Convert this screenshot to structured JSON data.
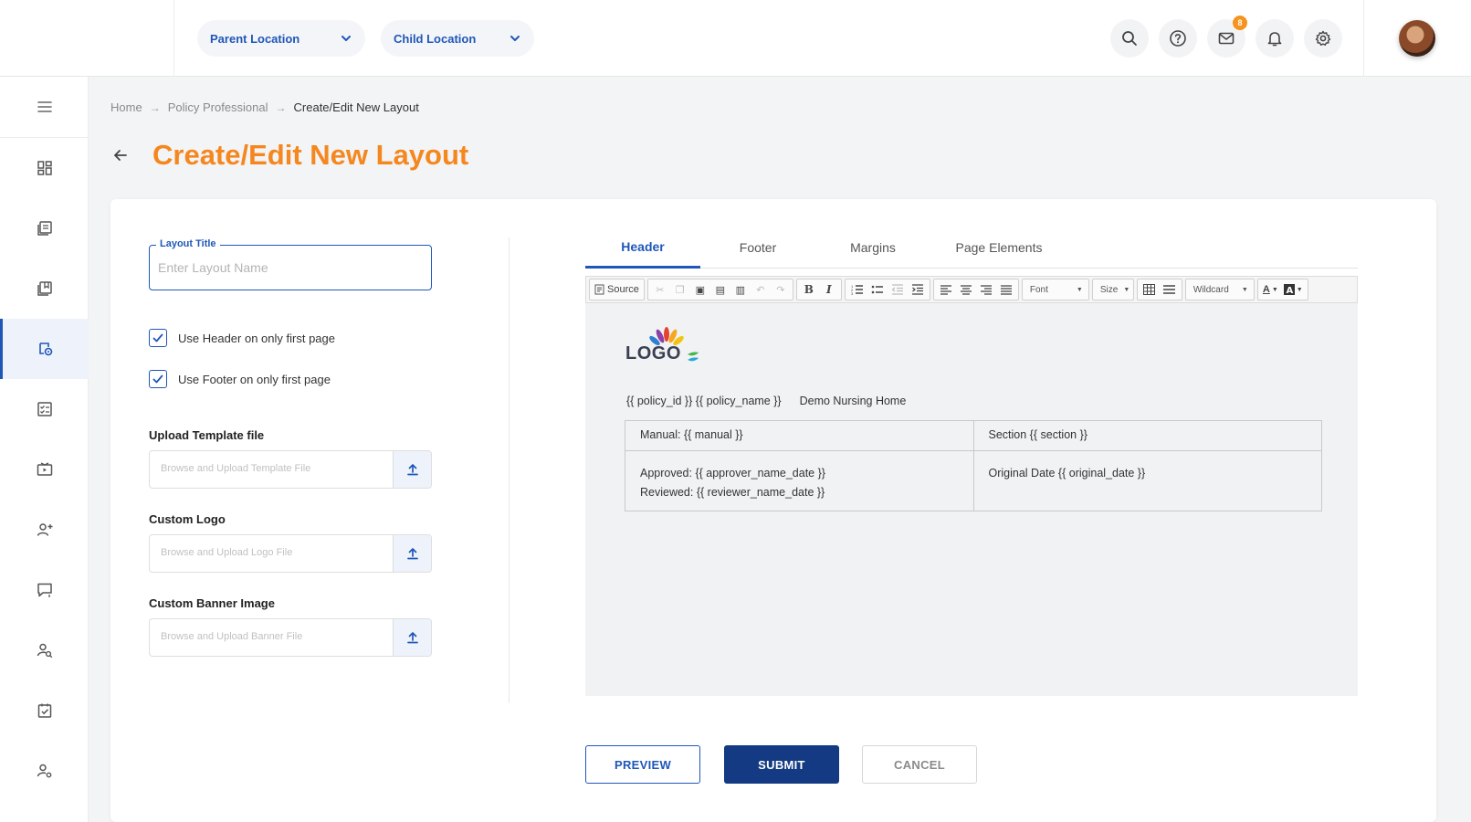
{
  "header": {
    "parent_location": "Parent Location",
    "child_location": "Child Location",
    "mail_badge": "8"
  },
  "breadcrumb": {
    "items": [
      "Home",
      "Policy Professional",
      "Create/Edit New Layout"
    ]
  },
  "page": {
    "title": "Create/Edit New Layout"
  },
  "form": {
    "layout_title_label": "Layout Title",
    "layout_title_placeholder": "Enter Layout Name",
    "layout_title_value": "",
    "use_header_first_page_label": "Use Header on only first page",
    "use_header_first_page_checked": true,
    "use_footer_first_page_label": "Use Footer on only first page",
    "use_footer_first_page_checked": true,
    "upload_template_label": "Upload Template file",
    "upload_template_placeholder": "Browse and Upload Template File",
    "custom_logo_label": "Custom Logo",
    "custom_logo_placeholder": "Browse and Upload Logo File",
    "custom_banner_label": "Custom Banner Image",
    "custom_banner_placeholder": "Browse and Upload Banner File"
  },
  "tabs": [
    {
      "label": "Header",
      "active": true
    },
    {
      "label": "Footer",
      "active": false
    },
    {
      "label": "Margins",
      "active": false
    },
    {
      "label": "Page Elements",
      "active": false
    }
  ],
  "toolbar": {
    "source_label": "Source",
    "bold_label": "B",
    "italic_label": "I",
    "font_label": "Font",
    "size_label": "Size",
    "wildcard_label": "Wildcard",
    "text_color_label": "A"
  },
  "editor": {
    "logo_text": "LOGO",
    "policy_line": "{{ policy_id }} {{ policy_name }}",
    "org_name": "Demo Nursing Home",
    "table": {
      "manual": "Manual:  {{ manual }}",
      "section": "Section {{ section }}",
      "approved": "Approved: {{ approver_name_date }}",
      "reviewed": "Reviewed: {{ reviewer_name_date }}",
      "original_date": "Original Date {{ original_date }}"
    }
  },
  "actions": {
    "preview": "PREVIEW",
    "submit": "SUBMIT",
    "cancel": "CANCEL"
  },
  "colors": {
    "accent_orange": "#f5871f",
    "primary_blue": "#1f57b8",
    "submit_navy": "#133a82",
    "badge_orange": "#f5931e"
  },
  "icons": {
    "sidebar": [
      "menu-icon",
      "dashboard-icon",
      "documents-icon",
      "library-icon",
      "policy-settings-icon",
      "checklist-icon",
      "video-icon",
      "user-plus-icon",
      "chat-icon",
      "user-search-icon",
      "task-check-icon",
      "user-settings-icon"
    ],
    "topbar": [
      "search-icon",
      "help-icon",
      "mail-icon",
      "bell-icon",
      "gear-icon"
    ]
  }
}
